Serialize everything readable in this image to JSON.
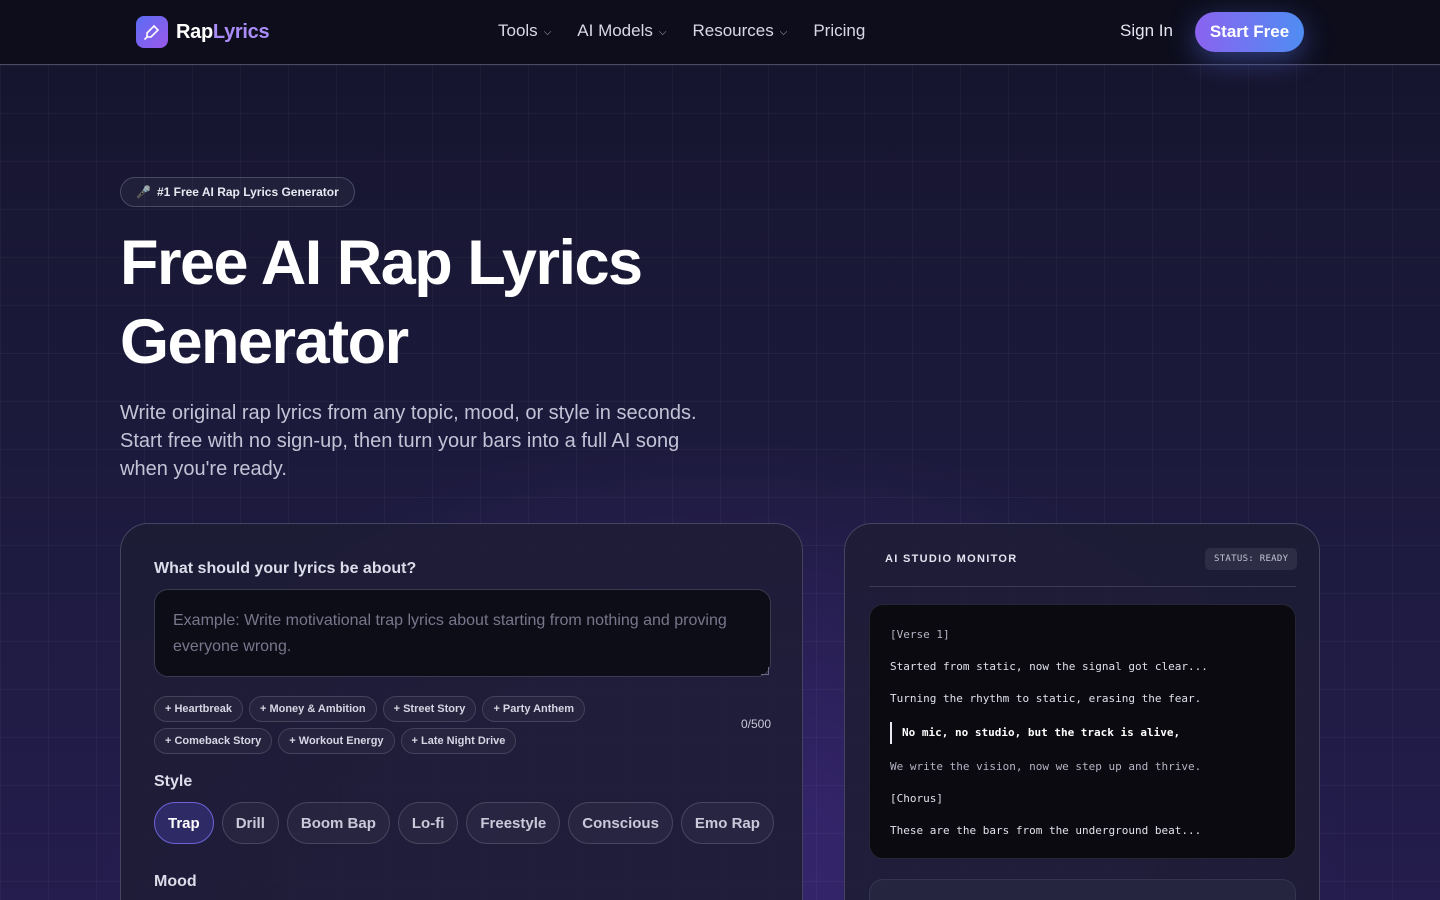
{
  "nav": {
    "brand_a": "Rap",
    "brand_b": "Lyrics",
    "menu": [
      {
        "label": "Tools",
        "has_dropdown": true
      },
      {
        "label": "AI Models",
        "has_dropdown": true
      },
      {
        "label": "Resources",
        "has_dropdown": true
      },
      {
        "label": "Pricing",
        "has_dropdown": false
      }
    ],
    "sign_in": "Sign In",
    "start_free": "Start Free"
  },
  "hero": {
    "badge_icon": "🎤",
    "badge": "#1 Free AI Rap Lyrics Generator",
    "title_line1": "Free AI Rap Lyrics",
    "title_line2": "Generator",
    "subtitle": "Write original rap lyrics from any topic, mood, or style in seconds. Start free with no sign-up, then turn your bars into a full AI song when you're ready."
  },
  "form": {
    "topic_label": "What should your lyrics be about?",
    "topic_placeholder": "Example: Write motivational trap lyrics about starting from nothing and proving everyone wrong.",
    "topic_value": "",
    "suggestions_row1": [
      "+ Heartbreak",
      "+ Money & Ambition",
      "+ Street Story",
      "+ Party Anthem"
    ],
    "suggestions_row2": [
      "+ Comeback Story",
      "+ Workout Energy",
      "+ Late Night Drive"
    ],
    "counter": "0/500",
    "style_label": "Style",
    "styles": [
      "Trap",
      "Drill",
      "Boom Bap",
      "Lo-fi",
      "Freestyle",
      "Conscious",
      "Emo Rap"
    ],
    "selected_style": "Trap",
    "mood_label": "Mood"
  },
  "monitor": {
    "title": "AI STUDIO MONITOR",
    "status": "STATUS: READY",
    "lines": [
      "[Verse 1]",
      "Started from static, now the signal got clear...",
      "Turning the rhythm to static, erasing the fear.",
      "No mic, no studio, but the track is alive,",
      "We write the vision, now we step up and thrive.",
      "[Chorus]",
      "These are the bars from the underground beat..."
    ]
  },
  "colors": {
    "accent_purple": "#8a63f0",
    "accent_blue": "#4f8df2",
    "brand_lyrics": "#a98cf8",
    "active_pill": "#2e2a66"
  },
  "icons": {
    "logo": "mic-pen-icon",
    "dropdown": "chevron-down-icon",
    "badge": "microphone-icon"
  }
}
